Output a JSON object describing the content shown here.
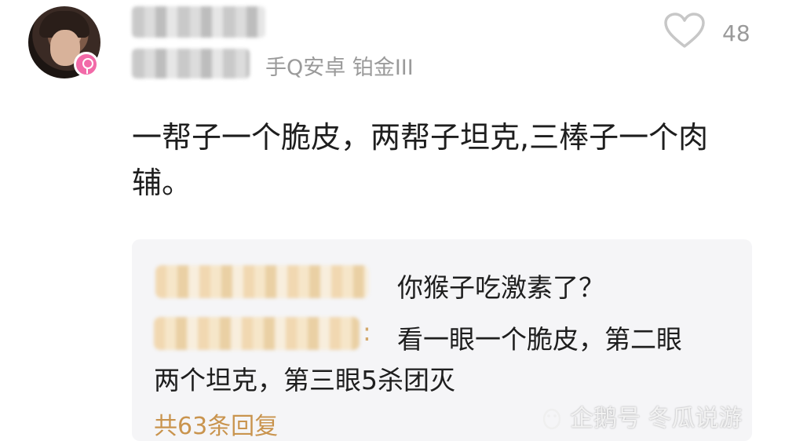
{
  "comment": {
    "device_rank": "手Q安卓 铂金III",
    "like_count": "48",
    "text": "一帮子一个脆皮，两帮子坦克,三棒子一个肉辅。",
    "icons": {
      "like": "heart-outline-icon",
      "gender": "female-icon"
    }
  },
  "replies": {
    "items": [
      {
        "text": "你猴子吃激素了？"
      },
      {
        "text_line1": "看一眼一个脆皮，第二眼",
        "text_line2": "两个坦克，第三眼5杀团灭"
      }
    ],
    "more_label": "共63条回复"
  },
  "watermark": {
    "text": "企鹅号 冬瓜说游",
    "icon": "penguin-icon"
  },
  "colors": {
    "link_gold": "#c9944e",
    "muted": "#9a9a9a",
    "reply_bg": "#f5f5f7",
    "badge_pink": "#f26aa8"
  }
}
